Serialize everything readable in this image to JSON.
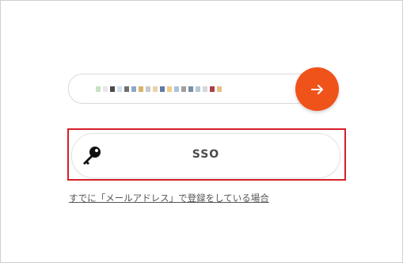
{
  "email_input": {
    "masked_colors": [
      "#c8e3c4",
      "#e8e8e8",
      "#4a4a4a",
      "#cfe0ee",
      "#6f6f6f",
      "#8aa9c8",
      "#d9b36a",
      "#c9c9c9",
      "#ead3a8",
      "#5b7da6",
      "#efcd8a",
      "#a7c3dc",
      "#9e9e9e",
      "#7b8f9f",
      "#b5c9d6",
      "#d7d7d7",
      "#a8404a",
      "#e6c18b"
    ]
  },
  "submit": {
    "icon": "arrow-right-icon",
    "color": "#f0531a"
  },
  "sso": {
    "label": "SSO",
    "icon": "key-icon"
  },
  "link": {
    "text": "すでに「メールアドレス」で登録をしている場合"
  }
}
